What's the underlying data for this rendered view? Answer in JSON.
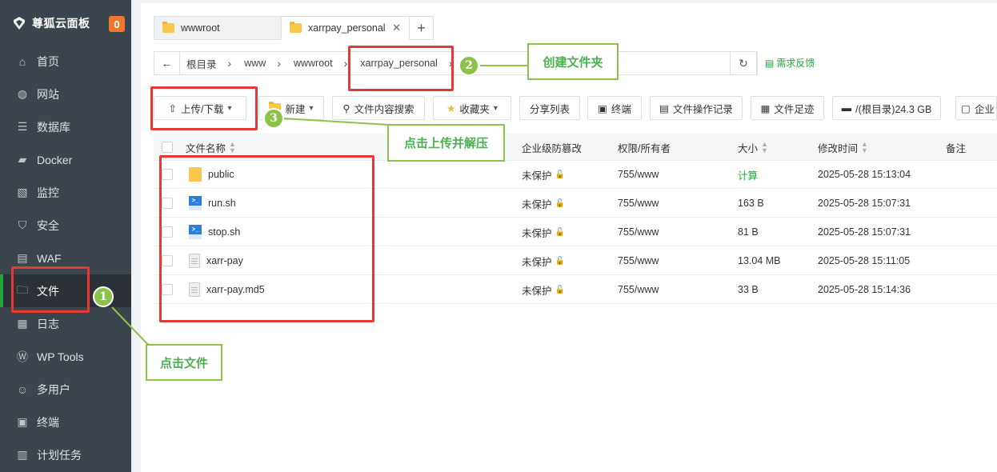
{
  "sidebar": {
    "brand": "尊狐云面板",
    "badge": "0",
    "items": [
      {
        "label": "首页",
        "icon": "home-icon"
      },
      {
        "label": "网站",
        "icon": "globe-icon"
      },
      {
        "label": "数据库",
        "icon": "database-icon"
      },
      {
        "label": "Docker",
        "icon": "docker-icon"
      },
      {
        "label": "监控",
        "icon": "monitor-icon"
      },
      {
        "label": "安全",
        "icon": "shield-icon"
      },
      {
        "label": "WAF",
        "icon": "waf-icon"
      },
      {
        "label": "文件",
        "icon": "folder-icon",
        "active": true
      },
      {
        "label": "日志",
        "icon": "log-icon"
      },
      {
        "label": "WP Tools",
        "icon": "wordpress-icon"
      },
      {
        "label": "多用户",
        "icon": "users-icon"
      },
      {
        "label": "终端",
        "icon": "terminal-icon"
      },
      {
        "label": "计划任务",
        "icon": "calendar-icon"
      }
    ]
  },
  "tabs": [
    {
      "label": "wwwroot"
    },
    {
      "label": "xarrpay_personal"
    }
  ],
  "breadcrumb": [
    "根目录",
    "www",
    "wwwroot",
    "xarrpay_personal"
  ],
  "feedback": "需求反馈",
  "toolbar": {
    "upload": "上传/下载",
    "new": "新建",
    "search": "文件内容搜索",
    "favorites": "收藏夹",
    "share": "分享列表",
    "terminal": "终端",
    "oplog": "文件操作记录",
    "footprint": "文件足迹",
    "disk": "/(根目录)24.3 GB",
    "enterprise": "企业"
  },
  "table": {
    "headers": {
      "name": "文件名称",
      "protect": "企业级防篡改",
      "perm": "权限/所有者",
      "size": "大小",
      "mtime": "修改时间",
      "note": "备注"
    },
    "rows": [
      {
        "name": "public",
        "type": "folder",
        "protect": "未保护",
        "perm": "755/www",
        "size": "计算",
        "mtime": "2025-05-28 15:13:04"
      },
      {
        "name": "run.sh",
        "type": "shell",
        "protect": "未保护",
        "perm": "755/www",
        "size": "163 B",
        "mtime": "2025-05-28 15:07:31"
      },
      {
        "name": "stop.sh",
        "type": "shell",
        "protect": "未保护",
        "perm": "755/www",
        "size": "81 B",
        "mtime": "2025-05-28 15:07:31"
      },
      {
        "name": "xarr-pay",
        "type": "file",
        "protect": "未保护",
        "perm": "755/www",
        "size": "13.04 MB",
        "mtime": "2025-05-28 15:11:05"
      },
      {
        "name": "xarr-pay.md5",
        "type": "file",
        "protect": "未保护",
        "perm": "755/www",
        "size": "33 B",
        "mtime": "2025-05-28 15:14:36"
      }
    ]
  },
  "annotations": {
    "step1": {
      "num": "1",
      "label": "点击文件"
    },
    "step2": {
      "num": "2",
      "label": "创建文件夹"
    },
    "step3": {
      "num": "3",
      "label": "点击上传并解压"
    }
  },
  "colors": {
    "accent": "#20a53a",
    "annotation_red": "#e53935",
    "annotation_green": "#8bc34a",
    "sidebar_bg": "#3c444d"
  }
}
